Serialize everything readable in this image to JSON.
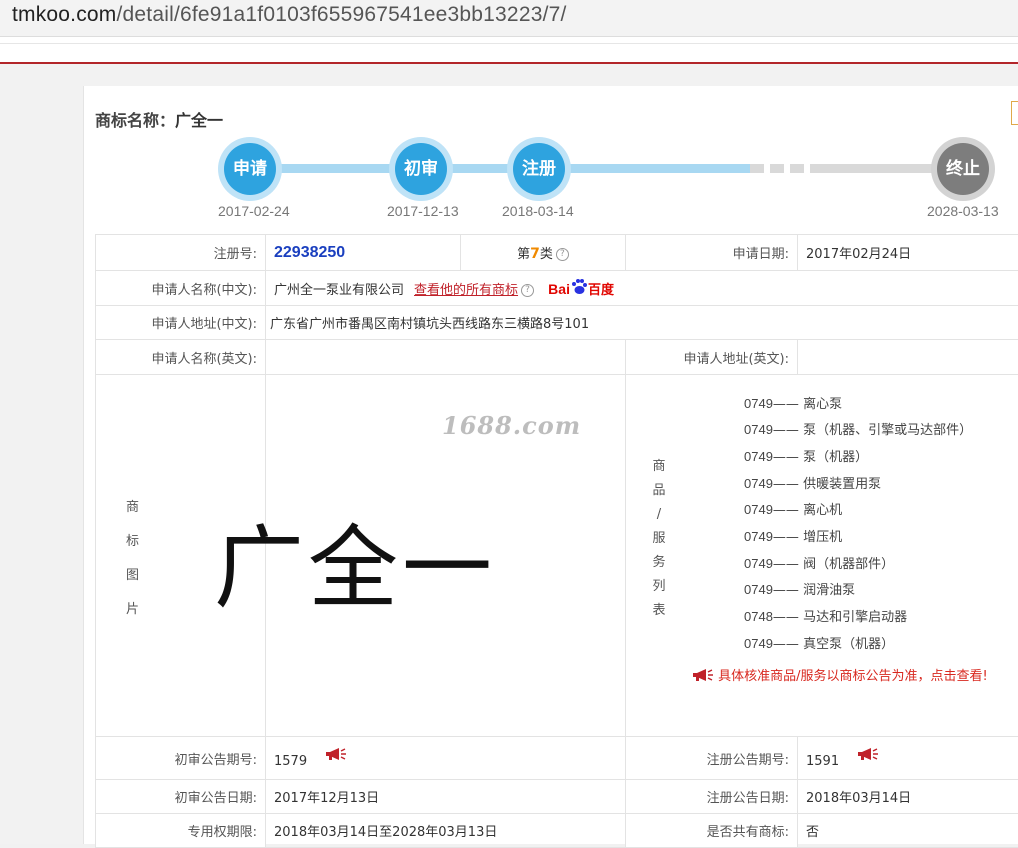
{
  "browser": {
    "url_host": "tmkoo.com",
    "url_path": "/detail/6fe91a1f0103f655967541ee3bb13223/7/"
  },
  "trademark": {
    "title_label": "商标名称：",
    "title_value": "广全一"
  },
  "timeline": [
    {
      "label": "申请",
      "date": "2017-02-24",
      "state": "done"
    },
    {
      "label": "初审",
      "date": "2017-12-13",
      "state": "done"
    },
    {
      "label": "注册",
      "date": "2018-03-14",
      "state": "done"
    },
    {
      "label": "终止",
      "date": "2028-03-13",
      "state": "future"
    }
  ],
  "info": {
    "reg_no_label": "注册号:",
    "reg_no": "22938250",
    "class_prefix": "第",
    "class_num": "7",
    "class_suffix": "类",
    "qmark": "?",
    "apply_date_label": "申请日期:",
    "apply_date": "2017年02月24日",
    "applicant_cn_label": "申请人名称(中文):",
    "applicant_cn": "广州全一泵业有限公司",
    "all_marks_link": "查看他的所有商标",
    "baidu_bai": "Bai",
    "baidu_du": "百度",
    "address_cn_label": "申请人地址(中文):",
    "address_cn": "广东省广州市番禺区南村镇坑头西线路东三横路8号101",
    "applicant_en_label": "申请人名称(英文):",
    "applicant_en": "",
    "address_en_label": "申请人地址(英文):",
    "address_en": "",
    "image_label": [
      "商",
      "标",
      "图",
      "片"
    ],
    "watermark": "1688.com",
    "mark_text": "广全一",
    "goods_label": [
      "商",
      "品",
      "/",
      "服",
      "务",
      "列",
      "表"
    ],
    "goods": [
      {
        "code": "0749",
        "name": "离心泵"
      },
      {
        "code": "0749",
        "name": "泵（机器、引擎或马达部件）"
      },
      {
        "code": "0749",
        "name": "泵（机器）"
      },
      {
        "code": "0749",
        "name": "供暖装置用泵"
      },
      {
        "code": "0749",
        "name": "离心机"
      },
      {
        "code": "0749",
        "name": "增压机"
      },
      {
        "code": "0749",
        "name": "阀（机器部件）"
      },
      {
        "code": "0749",
        "name": "润滑油泵"
      },
      {
        "code": "0748",
        "name": "马达和引擎启动器"
      },
      {
        "code": "0749",
        "name": "真空泵（机器）"
      }
    ],
    "goods_dash": "——",
    "goods_notice": "具体核准商品/服务以商标公告为准，点击查看!",
    "prelim_issue_label": "初审公告期号:",
    "prelim_issue": "1579",
    "reg_issue_label": "注册公告期号:",
    "reg_issue": "1591",
    "prelim_date_label": "初审公告日期:",
    "prelim_date": "2017年12月13日",
    "reg_date_label": "注册公告日期:",
    "reg_date": "2018年03月14日",
    "exclusive_label": "专用权期限:",
    "exclusive": "2018年03月14日至2028年03月13日",
    "shared_label": "是否共有商标:",
    "shared": "否"
  },
  "colors": {
    "accent_blue": "#2ea3df",
    "link_red": "#c0222a",
    "reg_no_blue": "#1a3fbf"
  }
}
